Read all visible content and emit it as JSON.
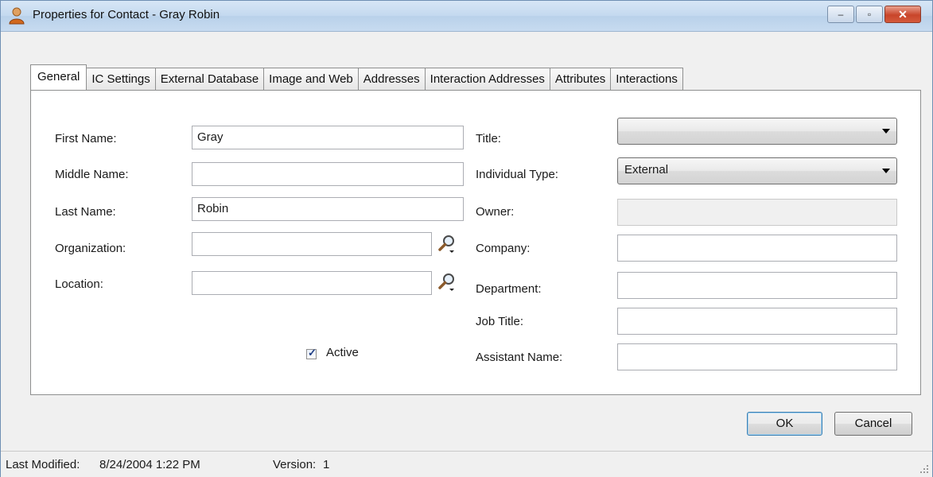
{
  "window": {
    "title": "Properties for Contact - Gray Robin",
    "controls": {
      "minimize": "–",
      "restore": "▫",
      "close": "✕"
    }
  },
  "tabs": [
    {
      "label": "General",
      "active": true
    },
    {
      "label": "IC Settings"
    },
    {
      "label": "External Database"
    },
    {
      "label": "Image and Web"
    },
    {
      "label": "Addresses"
    },
    {
      "label": "Interaction Addresses"
    },
    {
      "label": "Attributes"
    },
    {
      "label": "Interactions"
    }
  ],
  "form": {
    "first_name_label": "First Name:",
    "first_name_value": "Gray",
    "middle_name_label": "Middle Name:",
    "middle_name_value": "",
    "last_name_label": "Last Name:",
    "last_name_value": "Robin",
    "organization_label": "Organization:",
    "organization_value": "",
    "location_label": "Location:",
    "location_value": "",
    "active_label": "Active",
    "active_checked": true,
    "title_label": "Title:",
    "title_value": "",
    "individual_type_label": "Individual Type:",
    "individual_type_value": "External",
    "owner_label": "Owner:",
    "owner_value": "",
    "company_label": "Company:",
    "company_value": "",
    "department_label": "Department:",
    "department_value": "",
    "job_title_label": "Job Title:",
    "job_title_value": "",
    "assistant_name_label": "Assistant Name:",
    "assistant_name_value": ""
  },
  "buttons": {
    "ok": "OK",
    "cancel": "Cancel"
  },
  "status": {
    "last_modified_label": "Last Modified:",
    "last_modified_value": "8/24/2004 1:22 PM",
    "version_label": "Version:",
    "version_value": "1"
  },
  "icons": {
    "app": "contact-person-icon",
    "lookup": "magnifier-icon"
  },
  "colors": {
    "titlebar": "#c4d9ef",
    "close_button": "#c8452a",
    "panel_bg": "#ffffff",
    "window_bg": "#f0f0f0"
  }
}
